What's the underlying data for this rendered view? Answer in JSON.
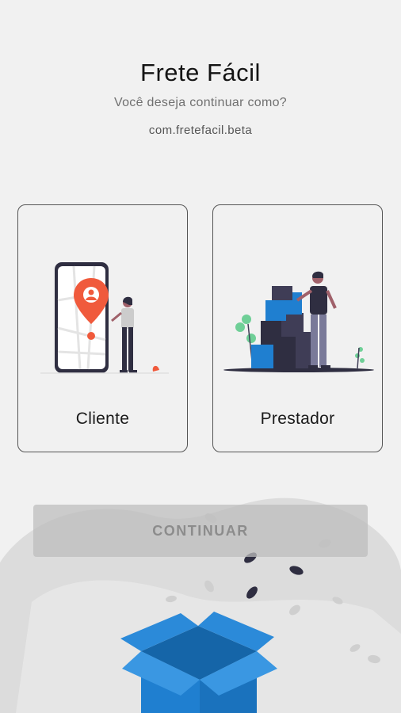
{
  "header": {
    "title": "Frete Fácil",
    "subtitle": "Você deseja continuar como?",
    "package": "com.fretefacil.beta"
  },
  "options": [
    {
      "label": "Cliente",
      "illustration": "map-pin-phone-person-illustration"
    },
    {
      "label": "Prestador",
      "illustration": "boxes-worker-illustration"
    }
  ],
  "footer": {
    "continue_label": "CONTINUAR",
    "continue_enabled": false,
    "illustration": "open-box-leaves-illustration"
  },
  "colors": {
    "background": "#f1f1f1",
    "accent_orange": "#f05a3c",
    "box_blue": "#1f7fd0",
    "dark": "#2f2e41"
  }
}
